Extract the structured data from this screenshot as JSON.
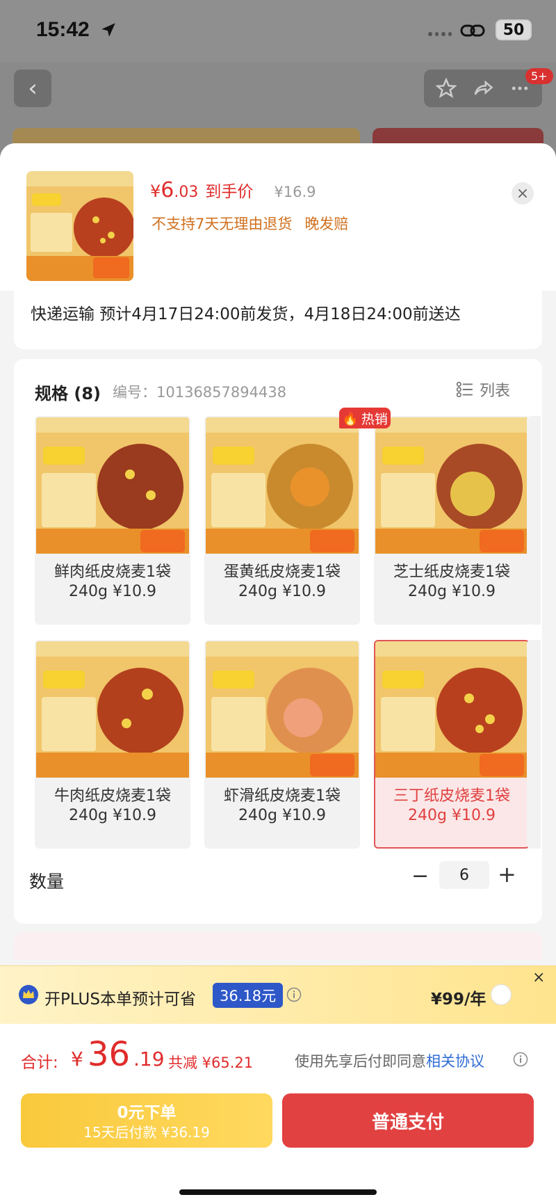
{
  "status": {
    "time": "15:42",
    "battery": "50"
  },
  "nav": {
    "back": "‹",
    "badge": "5+"
  },
  "header": {
    "yen": "¥",
    "price_int": "6",
    "price_dec": ".03",
    "price_tag": "到手价",
    "orig_price": "¥16.9",
    "notes": [
      "不支持7天无理由退货",
      "晚发赔"
    ],
    "close": "×"
  },
  "shipping": {
    "text": "快递运输 预计4月17日24:00前发货，4月18日24:00前送达"
  },
  "spec": {
    "title": "规格 (8)",
    "code": "编号：10136857894438",
    "view_toggle": "列表",
    "hot_badge": "热销",
    "items": [
      {
        "name": "鲜肉纸皮烧麦1袋",
        "price": "240g ¥10.9",
        "filling": "#9a3a1e"
      },
      {
        "name": "蛋黄纸皮烧麦1袋",
        "price": "240g ¥10.9",
        "filling": "#e9922b"
      },
      {
        "name": "芝士纸皮烧麦1袋",
        "price": "240g ¥10.9",
        "filling": "#e7c24a"
      },
      {
        "name": "牛肉纸皮烧麦1袋",
        "price": "240g ¥10.9",
        "filling": "#b2401d"
      },
      {
        "name": "虾滑纸皮烧麦1袋",
        "price": "240g ¥10.9",
        "filling": "#f0a07a"
      },
      {
        "name": "三丁纸皮烧麦1袋",
        "price": "240g ¥10.9",
        "filling": "#b8401f",
        "selected": true
      }
    ]
  },
  "quantity": {
    "label": "数量",
    "minus": "−",
    "value": "6",
    "plus": "+"
  },
  "plus": {
    "text": "开PLUS本单预计可省",
    "save": "36.18元",
    "price": "¥99/年",
    "close": "×"
  },
  "footer": {
    "total_label": "合计:",
    "total_yen": "¥",
    "total_int": "36",
    "total_dec": ".19",
    "discount": "共减 ¥65.21",
    "agree_prefix": "使用先享后付即同意",
    "agree_link": "相关协议",
    "later_line1": "0元下单",
    "later_line2": "15天后付款 ¥36.19",
    "pay": "普通支付"
  },
  "colors": {
    "accent_red": "#e24141",
    "accent_yellow": "#f9c93c",
    "plus_blue": "#2e57c8"
  }
}
